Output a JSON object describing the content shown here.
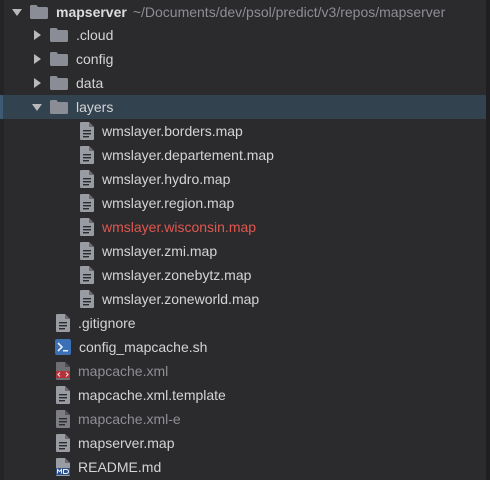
{
  "root": {
    "name": "mapserver",
    "path": "~/Documents/dev/psol/predict/v3/repos/mapserver"
  },
  "folders": [
    {
      "label": ".cloud",
      "expanded": false
    },
    {
      "label": "config",
      "expanded": false
    },
    {
      "label": "data",
      "expanded": false
    },
    {
      "label": "layers",
      "expanded": true,
      "selected": true
    }
  ],
  "layer_files": [
    "wmslayer.borders.map",
    "wmslayer.departement.map",
    "wmslayer.hydro.map",
    "wmslayer.region.map",
    "wmslayer.wisconsin.map",
    "wmslayer.zmi.map",
    "wmslayer.zonebytz.map",
    "wmslayer.zoneworld.map"
  ],
  "modified_file": "wmslayer.wisconsin.map",
  "root_files": [
    {
      "label": ".gitignore",
      "icon": "file-icon",
      "status": "normal"
    },
    {
      "label": "config_mapcache.sh",
      "icon": "terminal-icon",
      "status": "normal"
    },
    {
      "label": "mapcache.xml",
      "icon": "xml-icon",
      "status": "ignored"
    },
    {
      "label": "mapcache.xml.template",
      "icon": "file-icon",
      "status": "normal"
    },
    {
      "label": "mapcache.xml-e",
      "icon": "file-icon",
      "status": "ignored"
    },
    {
      "label": "mapserver.map",
      "icon": "file-icon",
      "status": "normal"
    },
    {
      "label": "README.md",
      "icon": "markdown-icon",
      "status": "normal"
    }
  ],
  "colors": {
    "background": "#2b2b2e",
    "selection": "#32424f",
    "modified": "#e0574f",
    "ignored": "#8f8f94",
    "folder": "#8a8d96",
    "terminal": "#3b6fb6",
    "xml": "#b4323a",
    "markdown": "#2f4f8a"
  }
}
